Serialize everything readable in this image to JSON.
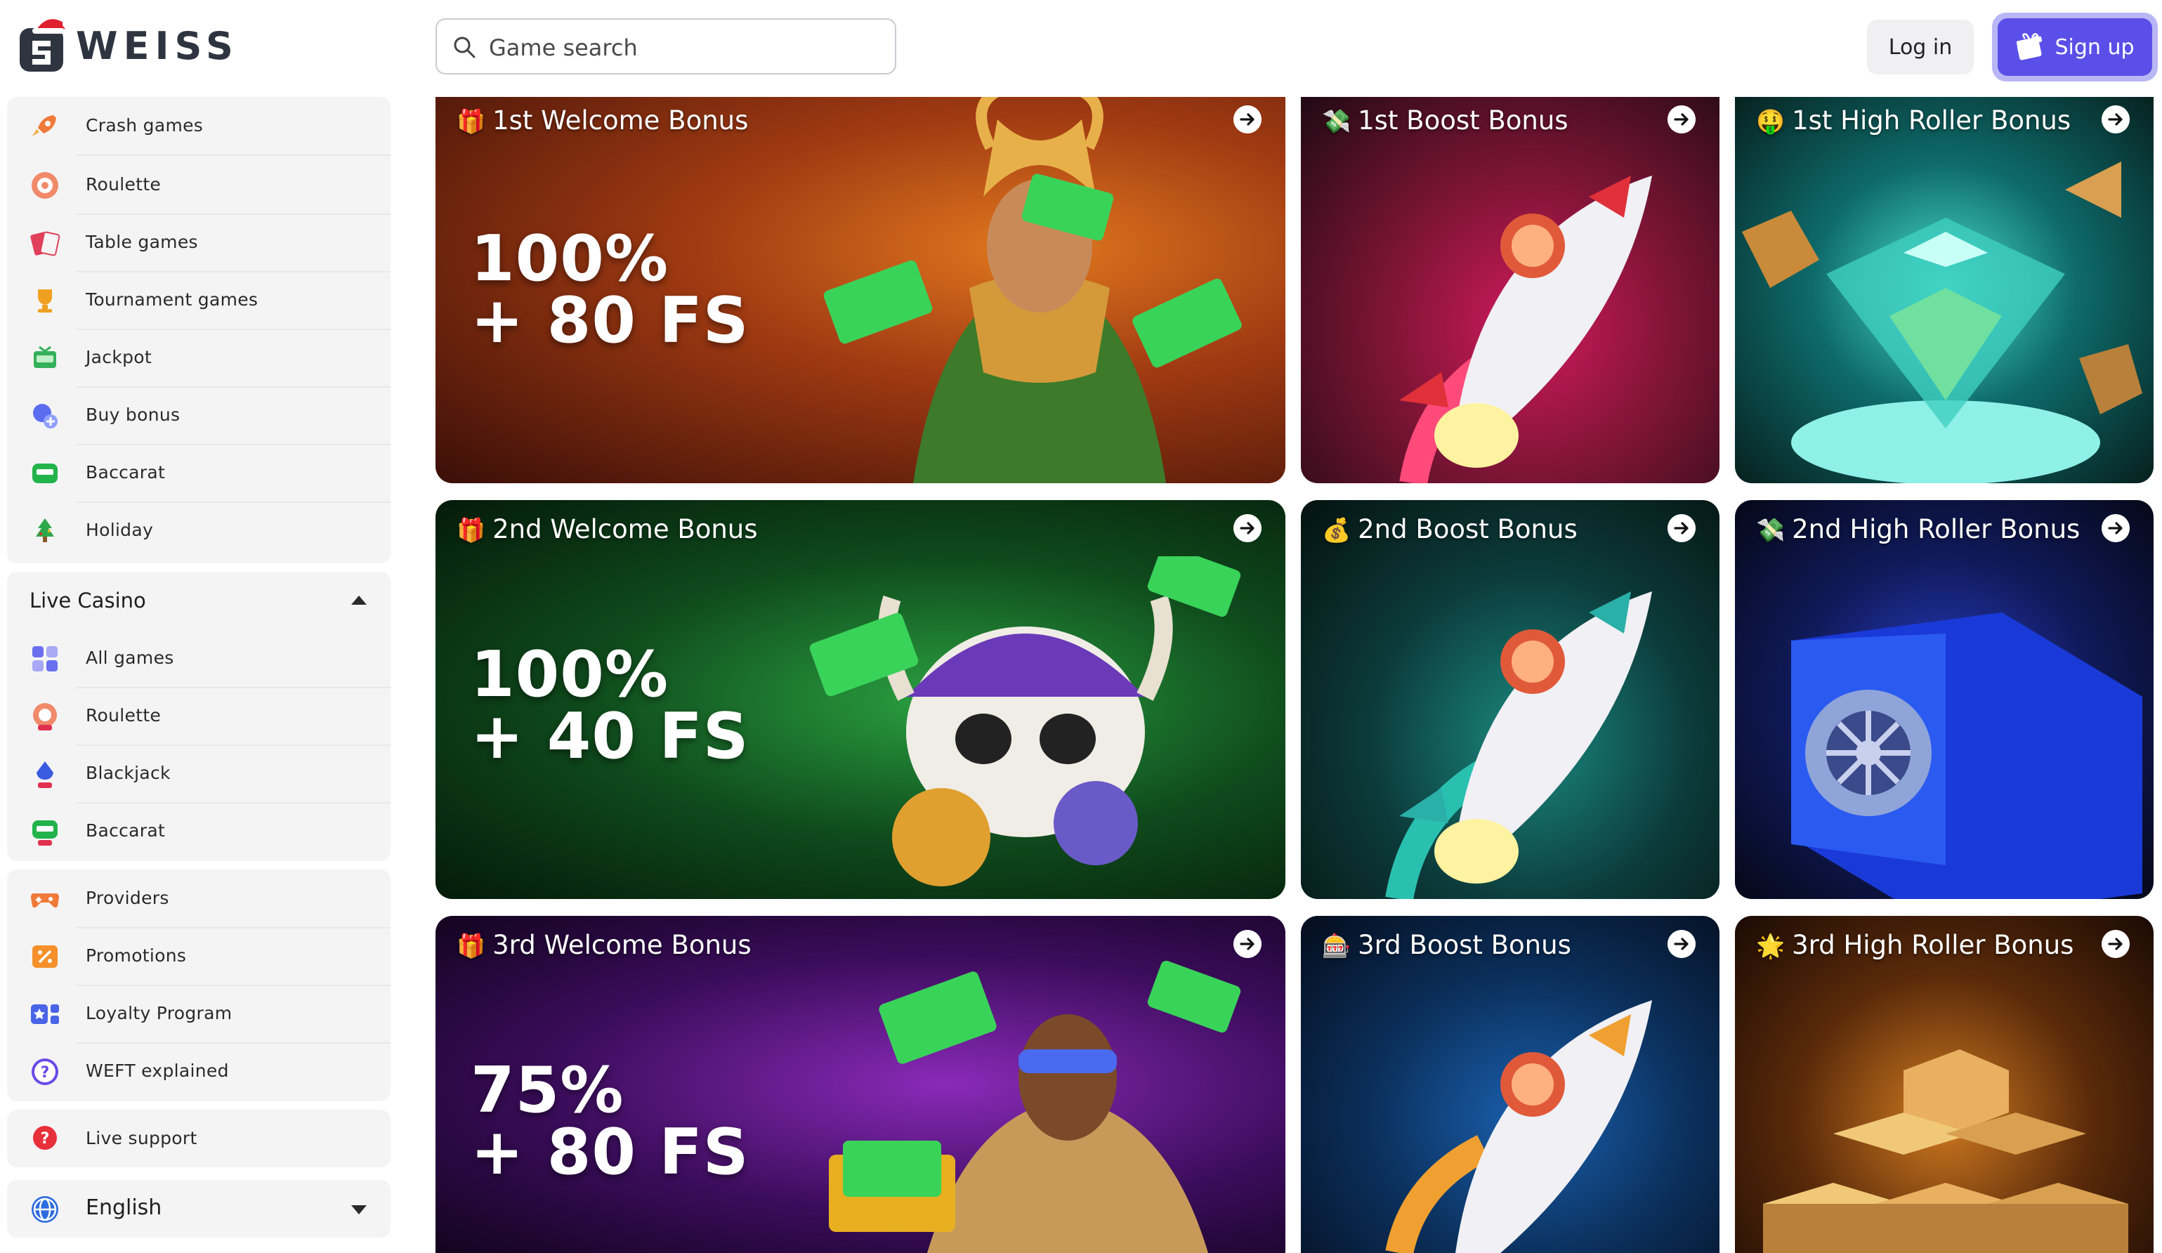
{
  "brand": {
    "name": "WEISS"
  },
  "search": {
    "placeholder": "Game search"
  },
  "auth": {
    "login_label": "Log in",
    "signup_label": "Sign up"
  },
  "sidebar": {
    "casino_items": [
      {
        "label": "Crash games",
        "icon": "rocket-icon"
      },
      {
        "label": "Roulette",
        "icon": "roulette-icon"
      },
      {
        "label": "Table games",
        "icon": "cards-icon"
      },
      {
        "label": "Tournament games",
        "icon": "trophy-icon"
      },
      {
        "label": "Jackpot",
        "icon": "jackpot-icon"
      },
      {
        "label": "Buy bonus",
        "icon": "buy-bonus-icon"
      },
      {
        "label": "Baccarat",
        "icon": "baccarat-icon"
      },
      {
        "label": "Holiday",
        "icon": "holiday-tree-icon"
      }
    ],
    "live_casino": {
      "title": "Live Casino",
      "items": [
        {
          "label": "All games",
          "icon": "live-grid-icon"
        },
        {
          "label": "Roulette",
          "icon": "live-roulette-icon"
        },
        {
          "label": "Blackjack",
          "icon": "live-blackjack-icon"
        },
        {
          "label": "Baccarat",
          "icon": "live-baccarat-icon"
        }
      ]
    },
    "info_items": [
      {
        "label": "Providers",
        "icon": "gamepad-icon"
      },
      {
        "label": "Promotions",
        "icon": "percent-icon"
      },
      {
        "label": "Loyalty Program",
        "icon": "loyalty-icon"
      },
      {
        "label": "WEFT explained",
        "icon": "question-icon"
      }
    ],
    "support": {
      "label": "Live support",
      "icon": "support-icon"
    },
    "language": {
      "label": "English",
      "icon": "globe-icon"
    }
  },
  "bonuses": [
    {
      "title": "1st Welcome Bonus",
      "emoji": "🎁",
      "offer_line1": "100%",
      "offer_line2": "+ 80 FS"
    },
    {
      "title": "1st Boost Bonus",
      "emoji": "💸"
    },
    {
      "title": "1st High Roller Bonus",
      "emoji": "🤑"
    },
    {
      "title": "2nd Welcome Bonus",
      "emoji": "🎁",
      "offer_line1": "100%",
      "offer_line2": "+ 40 FS"
    },
    {
      "title": "2nd Boost Bonus",
      "emoji": "💰"
    },
    {
      "title": "2nd High Roller Bonus",
      "emoji": "💸"
    },
    {
      "title": "3rd Welcome Bonus",
      "emoji": "🎁",
      "offer_line1": "75%",
      "offer_line2": "+ 80 FS"
    },
    {
      "title": "3rd Boost Bonus",
      "emoji": "🎰"
    },
    {
      "title": "3rd High Roller Bonus",
      "emoji": "🌟"
    }
  ],
  "colors": {
    "accent": "#5b4fe9",
    "sidebar_bg": "#f4f4f5",
    "card1_bg": "#7a2a10",
    "card2_bg": "#7d1436",
    "card3_bg": "#0e6a6a",
    "card4_bg": "#0f4a1c",
    "card5_bg": "#0c3a3a",
    "card6_bg": "#101a5a",
    "card7_bg": "#3a0c5a",
    "card8_bg": "#0b2f5a",
    "card9_bg": "#5a2a0a"
  }
}
